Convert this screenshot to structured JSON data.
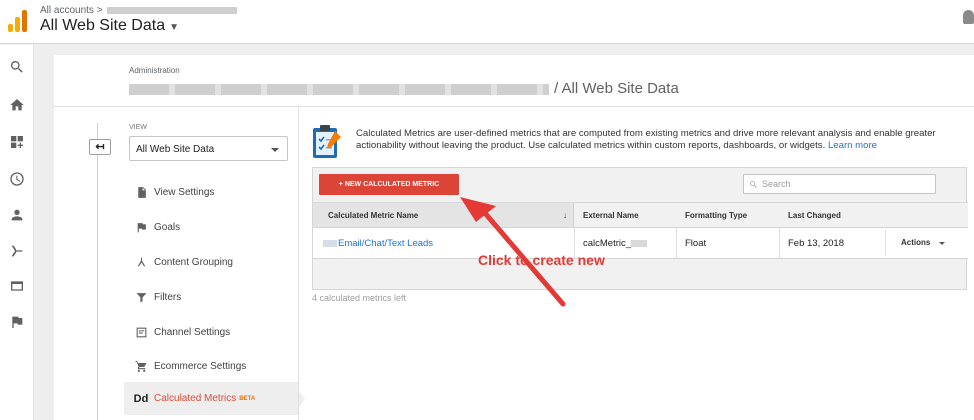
{
  "header": {
    "breadcrumb": "All accounts",
    "breadcrumb_sep": ">",
    "account_title": "All Web Site Data"
  },
  "admin": {
    "label": "Administration",
    "title": "/ All Web Site Data"
  },
  "view": {
    "label": "VIEW",
    "selected": "All Web Site Data"
  },
  "menu": [
    {
      "label": "View Settings",
      "icon": "document-icon"
    },
    {
      "label": "Goals",
      "icon": "flag-icon"
    },
    {
      "label": "Content Grouping",
      "icon": "grouping-icon"
    },
    {
      "label": "Filters",
      "icon": "filter-icon"
    },
    {
      "label": "Channel Settings",
      "icon": "channel-settings-icon"
    },
    {
      "label": "Ecommerce Settings",
      "icon": "cart-icon"
    },
    {
      "label": "Calculated Metrics",
      "icon": "dd-icon",
      "icon_text": "Dd",
      "badge": "BETA",
      "active": true
    }
  ],
  "intro": {
    "text": "Calculated Metrics are user-defined metrics that are computed from existing metrics and drive more relevant analysis and enable greater actionability without leaving the product. Use calculated metrics within custom reports, dashboards, or widgets.",
    "link": "Learn more"
  },
  "toolbar": {
    "new_button": "+ NEW CALCULATED METRIC",
    "search_placeholder": "Search"
  },
  "table": {
    "columns": [
      "Calculated Metric Name",
      "External Name",
      "Formatting Type",
      "Last Changed"
    ],
    "sort_indicator": "↓",
    "rows": [
      {
        "name": "Email/Chat/Text Leads",
        "external": "calcMetric_",
        "format": "Float",
        "changed": "Feb 13, 2018",
        "actions": "Actions"
      }
    ]
  },
  "footer": {
    "metrics_left": "4 calculated metrics left"
  },
  "annotation": {
    "callout": "Click to create new",
    "color": "#e53935"
  },
  "colors": {
    "accent_red": "#db4437",
    "link_blue": "#1a73e8",
    "beta_orange": "#e8710a"
  }
}
